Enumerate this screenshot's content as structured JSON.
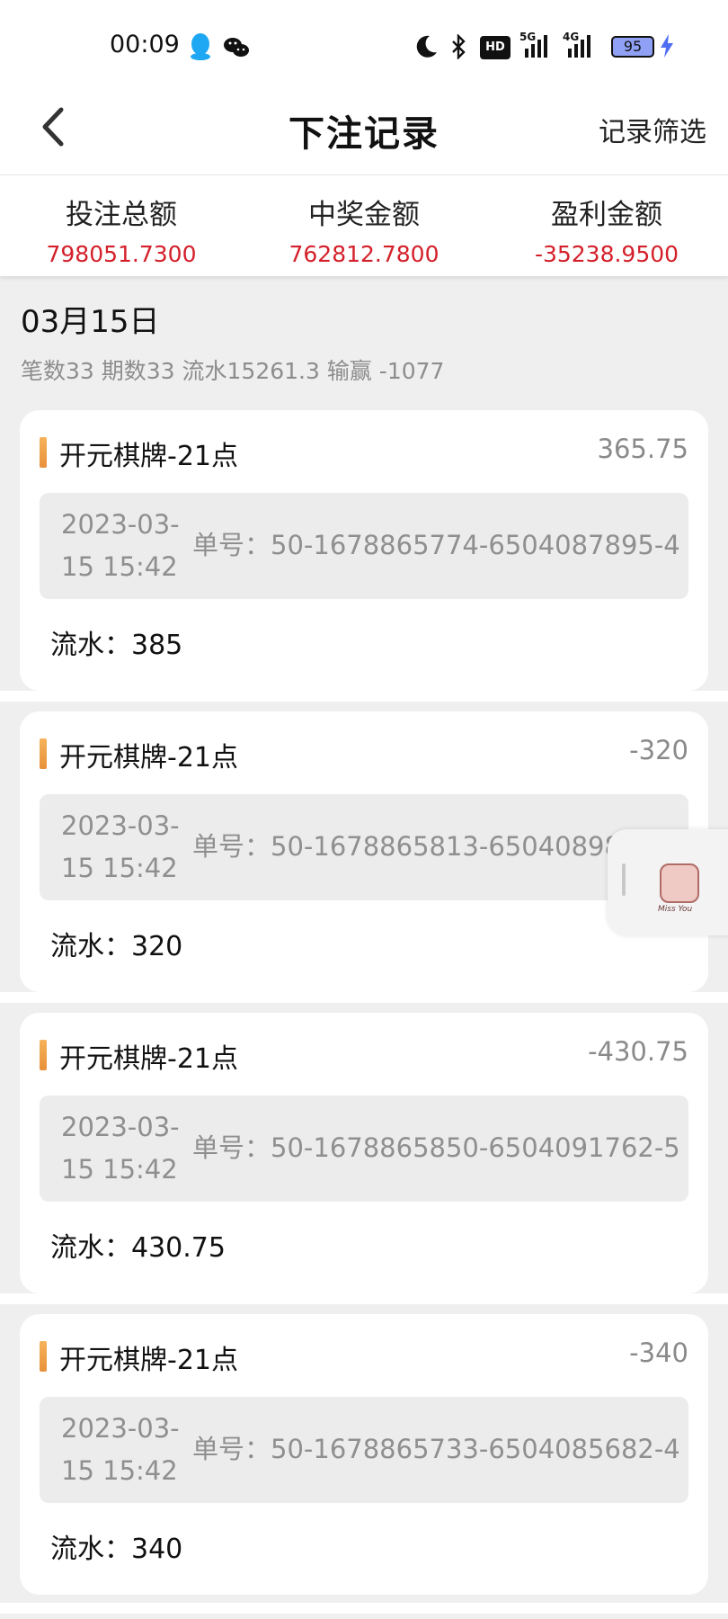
{
  "status_bar": {
    "time": "00:09",
    "icons": [
      "qq-icon",
      "wechat-icon",
      "moon-icon",
      "bluetooth-icon",
      "hd-icon",
      "signal-5g-icon",
      "signal-4g-icon",
      "battery-icon",
      "charging-icon"
    ],
    "hd_label": "HD",
    "net1": "5G",
    "net2": "4G",
    "battery": "95"
  },
  "header": {
    "title": "下注记录",
    "filter_label": "记录筛选"
  },
  "summary": {
    "items": [
      {
        "label": "投注总额",
        "value": "798051.7300"
      },
      {
        "label": "中奖金额",
        "value": "762812.7800"
      },
      {
        "label": "盈利金额",
        "value": "-35238.9500"
      }
    ],
    "value_color": "#d4202a"
  },
  "day": {
    "date": "03月15日",
    "stats": "笔数33 期数33 流水15261.3 输赢 -1077"
  },
  "records": [
    {
      "game": "开元棋牌-21点",
      "amount": "365.75",
      "time": "2023-03-15 15:42",
      "order": "单号：50-1678865774-6504087895-4",
      "flow": "流水：385"
    },
    {
      "game": "开元棋牌-21点",
      "amount": "-320",
      "time": "2023-03-15 15:42",
      "order": "单号：50-1678865813-6504089830-4",
      "flow": "流水：320"
    },
    {
      "game": "开元棋牌-21点",
      "amount": "-430.75",
      "time": "2023-03-15 15:42",
      "order": "单号：50-1678865850-6504091762-5",
      "flow": "流水：430.75"
    },
    {
      "game": "开元棋牌-21点",
      "amount": "-340",
      "time": "2023-03-15 15:42",
      "order": "单号：50-1678865733-6504085682-4",
      "flow": "流水：340"
    }
  ],
  "floating_widget": {
    "caption": "Miss You"
  }
}
